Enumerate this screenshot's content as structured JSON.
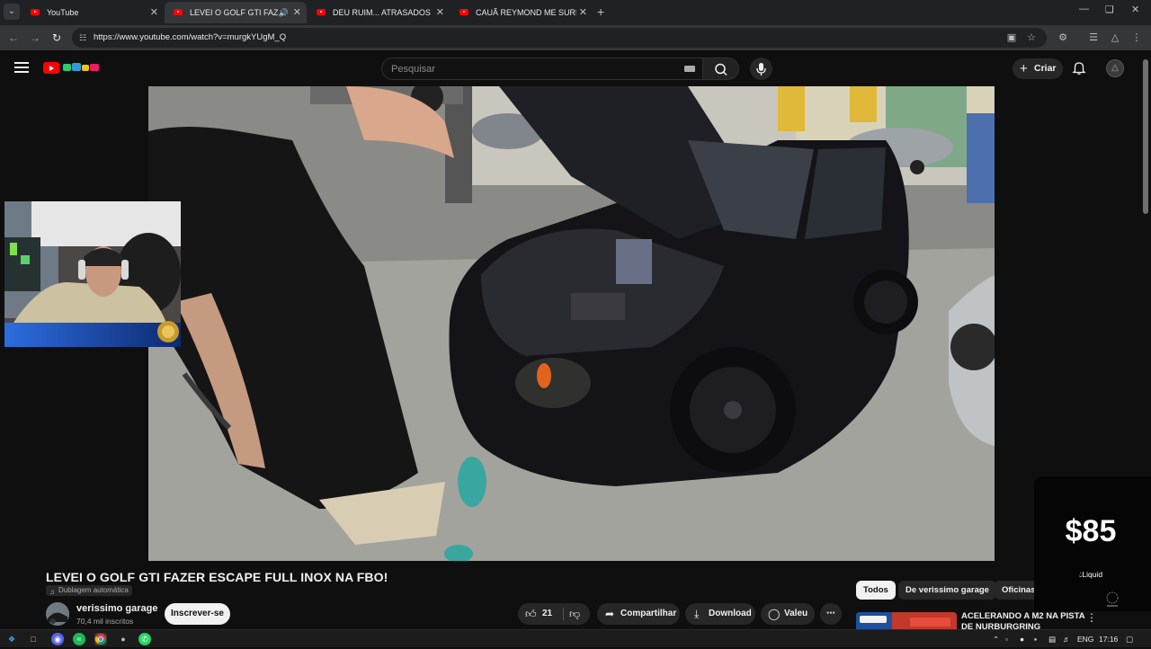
{
  "browser": {
    "tabs": [
      {
        "label": "YouTube"
      },
      {
        "label": "LEVEI O GOLF GTI FAZER ESCAPE FULL INOX NA FBO!"
      },
      {
        "label": "DEU RUIM... ATRASADOS DE PUBLICAÇÃO"
      },
      {
        "label": "CAUÃ REYMOND ME SURPREENDEU"
      }
    ],
    "url": "https://www.youtube.com/watch?v=murgkYUgM_Q"
  },
  "masthead": {
    "search_placeholder": "Pesquisar",
    "create_label": "Criar"
  },
  "video": {
    "title": "LEVEI O GOLF GTI FAZER ESCAPE FULL INOX NA FBO!",
    "dub_badge": "Dublagem automática",
    "channel_name": "verissimo garage",
    "subscriber_count": "70,4 mil inscritos",
    "subscribe_label": "Inscrever-se",
    "like_count": "21",
    "share_label": "Compartilhar",
    "download_label": "Download",
    "thanks_label": "Valeu"
  },
  "chips": [
    "Todos",
    "De verissimo garage",
    "Oficinas mecân"
  ],
  "recommendation": {
    "title": "ACELERANDO A M2 NA PISTA DE NURBURGRING"
  },
  "price_widget": {
    "value": "$85",
    "label": "Liquid"
  },
  "taskbar": {
    "language": "ENG",
    "time": "17:16"
  },
  "colors": {
    "youtube_red": "#ff0000",
    "background": "#0f0f0f",
    "button_bg": "#272727"
  }
}
